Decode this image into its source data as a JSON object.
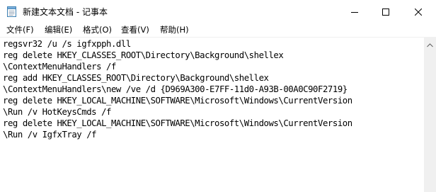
{
  "window": {
    "title": "新建文本文档 - 记事本"
  },
  "menu": [
    {
      "label": "文件(F)"
    },
    {
      "label": "编辑(E)"
    },
    {
      "label": "格式(O)"
    },
    {
      "label": "查看(V)"
    },
    {
      "label": "帮助(H)"
    }
  ],
  "editor": {
    "lines": [
      "regsvr32 /u /s igfxpph.dll",
      "reg delete HKEY_CLASSES_ROOT\\Directory\\Background\\shellex",
      "\\ContextMenuHandlers /f",
      "reg add HKEY_CLASSES_ROOT\\Directory\\Background\\shellex",
      "\\ContextMenuHandlers\\new /ve /d {D969A300-E7FF-11d0-A93B-00A0C90F2719}",
      "reg delete HKEY_LOCAL_MACHINE\\SOFTWARE\\Microsoft\\Windows\\CurrentVersion",
      "\\Run /v HotKeysCmds /f",
      "reg delete HKEY_LOCAL_MACHINE\\SOFTWARE\\Microsoft\\Windows\\CurrentVersion",
      "\\Run /v IgfxTray /f"
    ]
  },
  "icons": {
    "app": "notepad-icon",
    "minimize": "minimize-icon",
    "maximize": "maximize-icon",
    "close": "close-icon",
    "scroll_up": "scroll-up-arrow-icon"
  }
}
